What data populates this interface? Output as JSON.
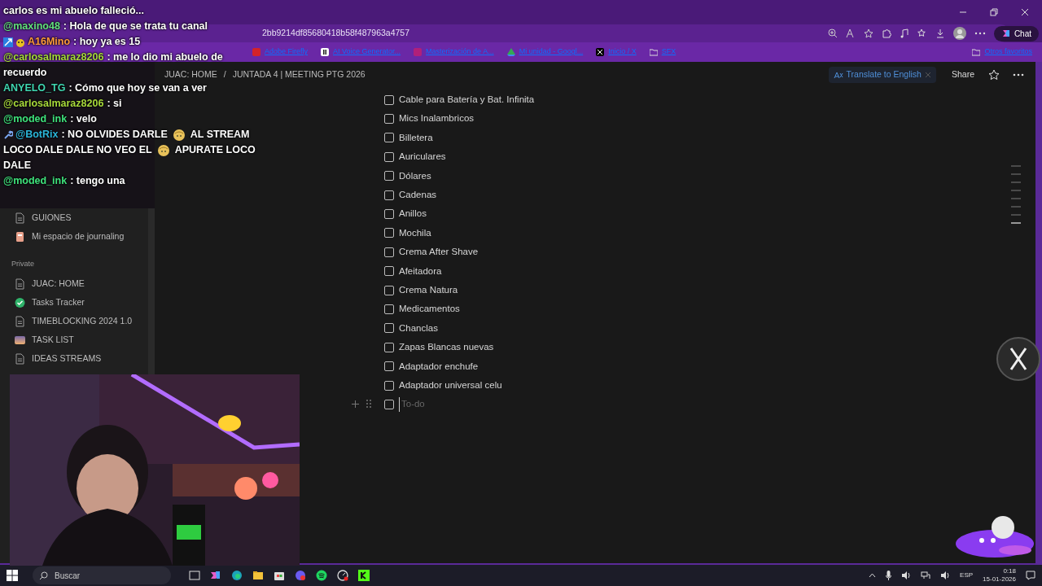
{
  "browser": {
    "url": "2bb9214df85680418b58f487963a4757",
    "bookmarks": [
      {
        "label": "Adobe Firefly"
      },
      {
        "label": "AI Voice Generator..."
      },
      {
        "label": "Masterización de A..."
      },
      {
        "label": "Mi unidad - Googl..."
      },
      {
        "label": "Inicio / X"
      },
      {
        "label": "SFX"
      }
    ],
    "other_bookmarks": "Otros favoritos",
    "chat_button": "Chat"
  },
  "chat_overlay": {
    "messages": [
      {
        "kind": "continuation",
        "lines": [
          [
            "carlos es mi abuelo falleció..."
          ]
        ]
      },
      {
        "kind": "plain",
        "user": "@maxino48",
        "color": "#62e07e",
        "lines": [
          [
            ": Hola de que se trata tu canal"
          ]
        ]
      },
      {
        "kind": "badged",
        "user": "A16Mino",
        "color": "#ff9a3c",
        "lines": [
          [
            ": hoy ya es 15"
          ]
        ]
      },
      {
        "kind": "plain",
        "user": "@carlosalmaraz8206",
        "color": "#a6d83a",
        "lines": [
          [
            ": me lo dio mi abuelo de"
          ],
          [
            "recuerdo"
          ]
        ]
      },
      {
        "kind": "plain",
        "user": "ANYELO_TG",
        "color": "#3fd6b0",
        "lines": [
          [
            ": Cómo que hoy se van a ver"
          ]
        ]
      },
      {
        "kind": "plain",
        "user": "@carlosalmaraz8206",
        "color": "#a6d83a",
        "lines": [
          [
            ": si"
          ]
        ]
      },
      {
        "kind": "plain",
        "user": "@moded_ink",
        "color": "#3fe27c",
        "lines": [
          [
            ": velo"
          ]
        ]
      },
      {
        "kind": "bot",
        "user": "@BotRix",
        "color": "#2bb5d8",
        "lines": [
          [
            ": NO OLVIDES DARLE",
            "AL STREAM"
          ],
          [
            "LOCO DALE DALE NO VEO EL",
            "APURATE LOCO"
          ],
          [
            "DALE"
          ]
        ]
      },
      {
        "kind": "plain",
        "user": "@moded_ink",
        "color": "#3fe27c",
        "lines": [
          [
            ": tengo una"
          ]
        ]
      }
    ]
  },
  "notion": {
    "breadcrumbs": [
      "JUAC: HOME",
      "JUNTADA 4 | MEETING PTG 2026"
    ],
    "breadcrumb_separator": "/",
    "translate": "Translate to English",
    "share": "Share",
    "sidebar": [
      {
        "kind": "page",
        "label": "GUIONES"
      },
      {
        "kind": "journal",
        "label": "Mi espacio de journaling"
      },
      {
        "kind": "heading",
        "label": "Private"
      },
      {
        "kind": "page",
        "label": "JUAC: HOME"
      },
      {
        "kind": "check",
        "label": "Tasks Tracker"
      },
      {
        "kind": "page",
        "label": "TIMEBLOCKING 2024 1.0"
      },
      {
        "kind": "gradient",
        "label": "TASK LIST"
      },
      {
        "kind": "page",
        "label": "IDEAS STREAMS"
      }
    ],
    "todos": [
      {
        "label": "Cable para Batería y Bat. Infinita",
        "checked": false
      },
      {
        "label": "Mics Inalambricos",
        "checked": false
      },
      {
        "label": "Billetera",
        "checked": false
      },
      {
        "label": "Auriculares",
        "checked": false
      },
      {
        "label": "Dólares",
        "checked": false
      },
      {
        "label": "Cadenas",
        "checked": false
      },
      {
        "label": "Anillos",
        "checked": false
      },
      {
        "label": "Mochila",
        "checked": false
      },
      {
        "label": "Crema After Shave",
        "checked": false
      },
      {
        "label": "Afeitadora",
        "checked": false
      },
      {
        "label": "Crema Natura",
        "checked": false
      },
      {
        "label": "Medicamentos",
        "checked": false
      },
      {
        "label": "Chanclas",
        "checked": false
      },
      {
        "label": "Zapas Blancas nuevas",
        "checked": false
      },
      {
        "label": "Adaptador enchufe",
        "checked": false
      },
      {
        "label": "Adaptador universal celu",
        "checked": false
      }
    ],
    "new_todo": {
      "placeholder": "To-do",
      "checked": false
    }
  },
  "taskbar": {
    "search": "Buscar",
    "language": "ESP",
    "time": "0:18",
    "date": "15-01-2026"
  }
}
